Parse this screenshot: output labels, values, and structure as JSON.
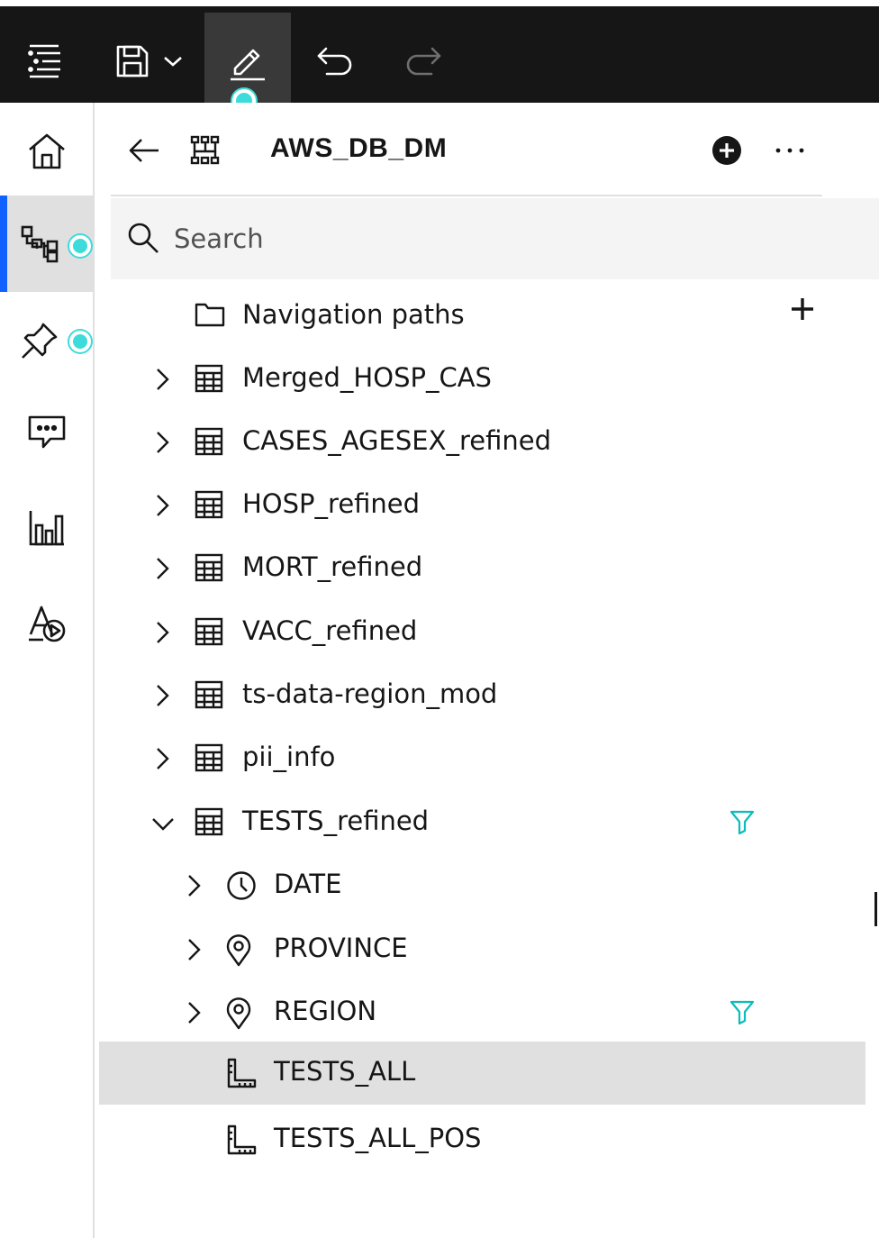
{
  "toolbar": {
    "items": [
      {
        "name": "outline-menu",
        "icon": "outline-list-icon"
      },
      {
        "name": "save",
        "icon": "save-icon",
        "has_dropdown": true
      },
      {
        "name": "edit",
        "icon": "pencil-icon",
        "active": true
      },
      {
        "name": "undo",
        "icon": "undo-icon"
      },
      {
        "name": "redo",
        "icon": "redo-icon",
        "disabled": true
      }
    ]
  },
  "rail": {
    "items": [
      {
        "name": "home",
        "icon": "home-icon"
      },
      {
        "name": "data-tree",
        "icon": "data-tree-icon",
        "active": true
      },
      {
        "name": "pins",
        "icon": "pin-icon"
      },
      {
        "name": "comments",
        "icon": "chat-icon"
      },
      {
        "name": "visualizations",
        "icon": "bar-chart-icon"
      },
      {
        "name": "assistant",
        "icon": "shapes-play-icon"
      }
    ]
  },
  "panel": {
    "title": "AWS_DB_DM",
    "search": {
      "placeholder": "Search",
      "value": ""
    },
    "tree": [
      {
        "label": "Navigation paths",
        "icon": "folder-icon",
        "level": 0,
        "expandable": false,
        "action": "add"
      },
      {
        "label": "Merged_HOSP_CAS",
        "icon": "table-icon",
        "level": 0,
        "expandable": true,
        "expanded": false
      },
      {
        "label": "CASES_AGESEX_refined",
        "icon": "table-icon",
        "level": 0,
        "expandable": true,
        "expanded": false
      },
      {
        "label": "HOSP_refined",
        "icon": "table-icon",
        "level": 0,
        "expandable": true,
        "expanded": false
      },
      {
        "label": "MORT_refined",
        "icon": "table-icon",
        "level": 0,
        "expandable": true,
        "expanded": false
      },
      {
        "label": "VACC_refined",
        "icon": "table-icon",
        "level": 0,
        "expandable": true,
        "expanded": false
      },
      {
        "label": "ts-data-region_mod",
        "icon": "table-icon",
        "level": 0,
        "expandable": true,
        "expanded": false
      },
      {
        "label": "pii_info",
        "icon": "table-icon",
        "level": 0,
        "expandable": true,
        "expanded": false
      },
      {
        "label": "TESTS_refined",
        "icon": "table-icon",
        "level": 0,
        "expandable": true,
        "expanded": true,
        "filtered": true
      },
      {
        "label": "DATE",
        "icon": "clock-icon",
        "level": 1,
        "expandable": true,
        "expanded": false
      },
      {
        "label": "PROVINCE",
        "icon": "location-icon",
        "level": 1,
        "expandable": true,
        "expanded": false
      },
      {
        "label": "REGION",
        "icon": "location-icon",
        "level": 1,
        "expandable": true,
        "expanded": false,
        "filtered": true
      },
      {
        "label": "TESTS_ALL",
        "icon": "measure-icon",
        "level": 1,
        "expandable": false,
        "selected": true
      },
      {
        "label": "TESTS_ALL_POS",
        "icon": "measure-icon",
        "level": 1,
        "expandable": false
      }
    ]
  },
  "colors": {
    "toolbar_bg": "#161616",
    "toolbar_active": "#393939",
    "accent_blue": "#0f62fe",
    "notification_teal": "#3ddbd9",
    "filter_teal": "#08bdba",
    "selected_row": "#e0e0e0",
    "search_bg": "#f4f4f4"
  }
}
